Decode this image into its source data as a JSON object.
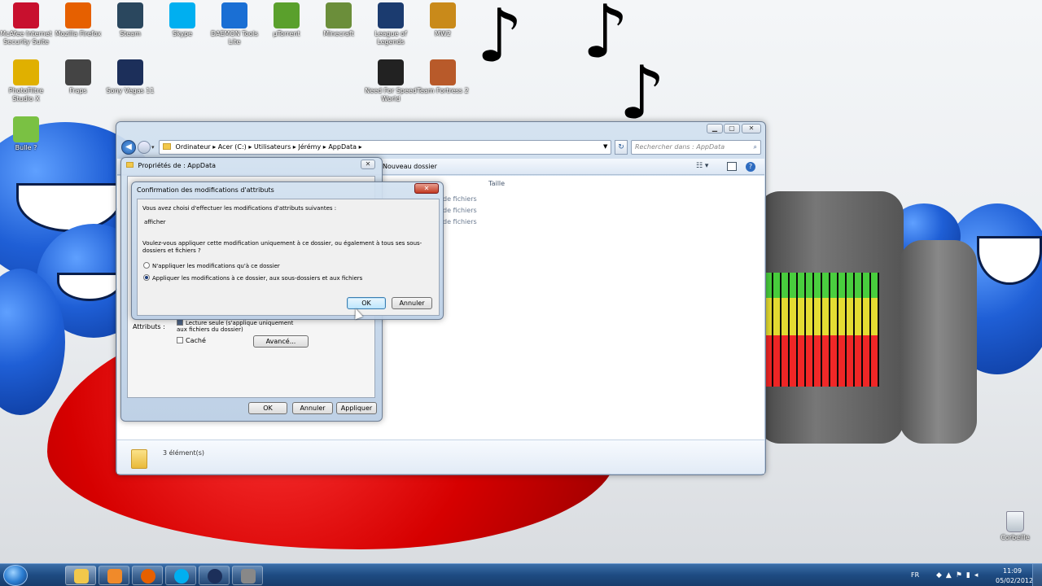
{
  "desktop": {
    "icons": [
      {
        "label": "McAfee Internet Security Suite",
        "color": "#c8102e"
      },
      {
        "label": "Mozilla Firefox",
        "color": "#e66000"
      },
      {
        "label": "Steam",
        "color": "#2a475e"
      },
      {
        "label": "Skype",
        "color": "#00aff0"
      },
      {
        "label": "DAEMON Tools Lite",
        "color": "#1a6fd4"
      },
      {
        "label": "µTorrent",
        "color": "#5aa02c"
      },
      {
        "label": "Minecraft",
        "color": "#6b8e3a"
      },
      {
        "label": "League of Legends",
        "color": "#1b3b6f"
      },
      {
        "label": "MW2",
        "color": "#c98a1a"
      },
      {
        "label": "PhotoFiltre Studio X",
        "color": "#e0b000"
      },
      {
        "label": "Fraps",
        "color": "#444444"
      },
      {
        "label": "Sony Vegas 11",
        "color": "#1c2f5a"
      },
      {
        "label": "Need For Speed World",
        "color": "#222222"
      },
      {
        "label": "Team Fortress 2",
        "color": "#b85a2a"
      },
      {
        "label": "Bulle ?",
        "color": "#7ac143"
      }
    ],
    "recycle_bin": "Corbeille"
  },
  "explorer": {
    "breadcrumb": [
      "Ordinateur",
      "Acer (C:)",
      "Utilisateurs",
      "Jérémy",
      "AppData"
    ],
    "search_placeholder": "Rechercher dans : AppData",
    "new_folder": "Nouveau dossier",
    "column_size": "Taille",
    "rows": [
      "de fichiers",
      "de fichiers",
      "de fichiers"
    ],
    "status": "3 élément(s)"
  },
  "properties": {
    "title": "Propriétés de : AppData",
    "attributes_label": "Attributs :",
    "readonly": "Lecture seule (s'applique uniquement aux fichiers du dossier)",
    "hidden": "Caché",
    "advanced": "Avancé...",
    "ok": "OK",
    "cancel": "Annuler",
    "apply": "Appliquer"
  },
  "confirm": {
    "title": "Confirmation des modifications d'attributs",
    "intro": "Vous avez choisi d'effectuer les modifications d'attributs suivantes :",
    "change": "afficher",
    "question": "Voulez-vous appliquer cette modification uniquement à ce dossier, ou également à tous ses sous-dossiers et fichiers ?",
    "option1": "N'appliquer les modifications qu'à ce dossier",
    "option2": "Appliquer les modifications à ce dossier, aux sous-dossiers et aux fichiers",
    "selected": 2,
    "ok": "OK",
    "cancel": "Annuler"
  },
  "taskbar": {
    "items": [
      "windows-explorer",
      "media-player",
      "firefox",
      "skype",
      "sony-vegas",
      "fraps"
    ],
    "lang": "FR",
    "time": "11:09",
    "date": "05/02/2012"
  }
}
